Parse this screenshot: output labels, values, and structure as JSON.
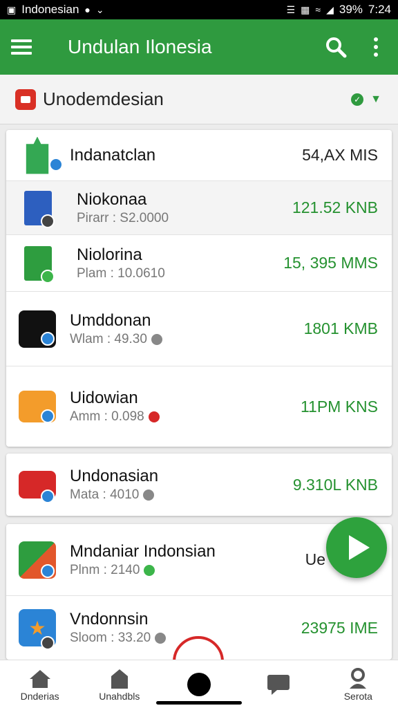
{
  "status_bar": {
    "carrier": "Indonesian",
    "battery": "39%",
    "time": "7:24"
  },
  "app_bar": {
    "title": "Undulan Ilonesia"
  },
  "section": {
    "title": "Unodemdesian"
  },
  "colors": {
    "accent": "#2f9a3f",
    "size_green": "#24912f",
    "error": "#d62828",
    "link_blue": "#2b84d6"
  },
  "cards": [
    {
      "rows": [
        {
          "name": "Indanatclan",
          "sub": "",
          "size": "54,AX MIS",
          "icon": "check-shield-icon",
          "badge": "blue"
        },
        {
          "name": "Niokonaa",
          "sub": "Pirarr : S2.0000",
          "size": "121.52 KNB",
          "icon": "document-icon",
          "badge": "dark"
        },
        {
          "name": "Niolorina",
          "sub": "Plam : 10.0610",
          "size": "15, 395 MMS",
          "icon": "document-green-icon",
          "badge": "green"
        },
        {
          "name": "Umddonan",
          "sub": "Wlam : 49.30",
          "size": "1801 KMB",
          "icon": "game-icon",
          "badge": "blue",
          "status": "grey"
        },
        {
          "name": "Uidowian",
          "sub": "Amm : 0.098",
          "size": "11PM KNS",
          "icon": "message-icon",
          "badge": "blue",
          "status": "red"
        }
      ]
    },
    {
      "rows": [
        {
          "name": "Undonasian",
          "sub": "Mata : 4010",
          "size": "9.310L KNB",
          "icon": "camera-icon",
          "badge": "blue",
          "status": "grey"
        }
      ]
    },
    {
      "rows": [
        {
          "name": "Mndaniar Indonsian",
          "sub": "Plnm : 2140",
          "size": "Ue",
          "icon": "spider-icon",
          "badge": "blue",
          "status": "green"
        },
        {
          "name": "Vndonnsin",
          "sub": "Sloom : 33.20",
          "size": "23975 IME",
          "icon": "star-icon",
          "badge": "dark",
          "status": "grey"
        }
      ]
    }
  ],
  "bottom_nav": [
    {
      "label": "Dnderias",
      "icon": "home-icon"
    },
    {
      "label": "Unahdbls",
      "icon": "tag-icon"
    },
    {
      "label": "",
      "icon": "record-icon"
    },
    {
      "label": "",
      "icon": "chat-icon"
    },
    {
      "label": "Serota",
      "icon": "person-icon"
    }
  ]
}
